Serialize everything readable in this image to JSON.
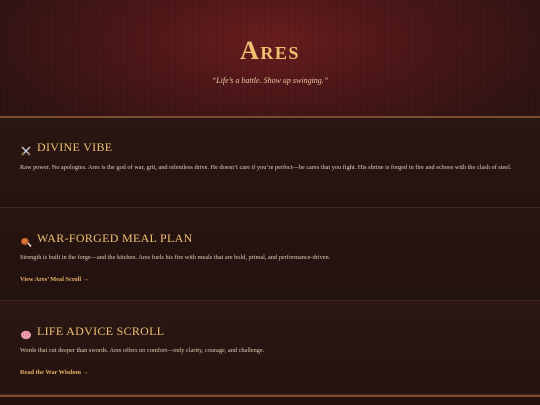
{
  "hero": {
    "title": "Ares",
    "tagline": "“Life’s a battle. Show up swinging.”"
  },
  "sections": [
    {
      "icon": "crossed-swords-icon",
      "title": "DIVINE VIBE",
      "text": "Raw power. No apologies. Ares is the god of war, grit, and relentless drive. He doesn’t care if you’re perfect—he cares that you fight. His shrine is forged in fire and echoes with the clash of steel."
    },
    {
      "icon": "meat-on-bone-icon",
      "title": "WAR-FORGED MEAL PLAN",
      "text": "Strength is built in the forge—and the kitchen. Ares fuels his fire with meals that are bold, primal, and performance-driven.",
      "link": "View Ares’ Meal Scroll →"
    },
    {
      "icon": "brain-icon",
      "title": "LIFE ADVICE SCROLL",
      "text": "Words that cut deeper than swords. Ares offers no comfort—only clarity, courage, and challenge.",
      "link": "Read the War Wisdom →"
    }
  ],
  "colors": {
    "accent_gold": "#f0c074",
    "link_gold": "#e6b265",
    "hero_red": "#6a1e1e",
    "background": "#24120f",
    "body_text": "#e2cdb8"
  }
}
